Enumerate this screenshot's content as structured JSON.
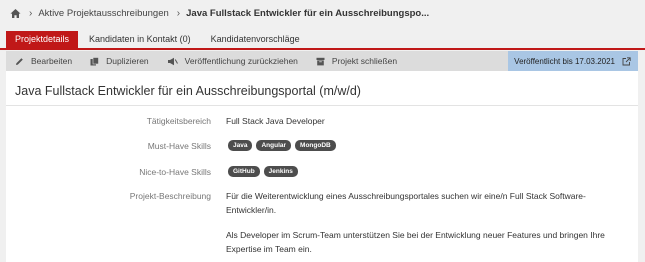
{
  "breadcrumb": {
    "home_icon": "home-icon",
    "items": [
      "Aktive Projektausschreibungen",
      "Java Fullstack Entwickler für ein Ausschreibungspo..."
    ]
  },
  "tabs": [
    {
      "label": "Projektdetails",
      "active": true
    },
    {
      "label": "Kandidaten in Kontakt (0)",
      "active": false
    },
    {
      "label": "Kandidatenvorschläge",
      "active": false
    }
  ],
  "toolbar": {
    "edit_label": "Bearbeiten",
    "duplicate_label": "Duplizieren",
    "withdraw_label": "Veröffentlichung zurückziehen",
    "close_label": "Projekt schließen",
    "published_label": "Veröffentlicht bis 17.03.2021"
  },
  "project": {
    "title": "Java Fullstack Entwickler für ein Ausschreibungsportal (m/w/d)",
    "field_label": "Tätigkeitsbereich",
    "field_value": "Full Stack Java Developer",
    "must_label": "Must-Have Skills",
    "must_skills": [
      "Java",
      "Angular",
      "MongoDB"
    ],
    "nice_label": "Nice-to-Have Skills",
    "nice_skills": [
      "GitHub",
      "Jenkins"
    ],
    "desc_label": "Projekt-Beschreibung",
    "desc_p1": "Für die Weiterentwicklung eines Ausschreibungsportales suchen wir eine/n Full Stack Software-Entwickler/in.",
    "desc_p2": "Als Developer im Scrum-Team unterstützen Sie bei der Entwicklung neuer Features und bringen Ihre Expertise im Team ein."
  },
  "colors": {
    "accent": "#c01818",
    "published_bg": "#a9c6e4",
    "badge": "#4d4d4d"
  }
}
